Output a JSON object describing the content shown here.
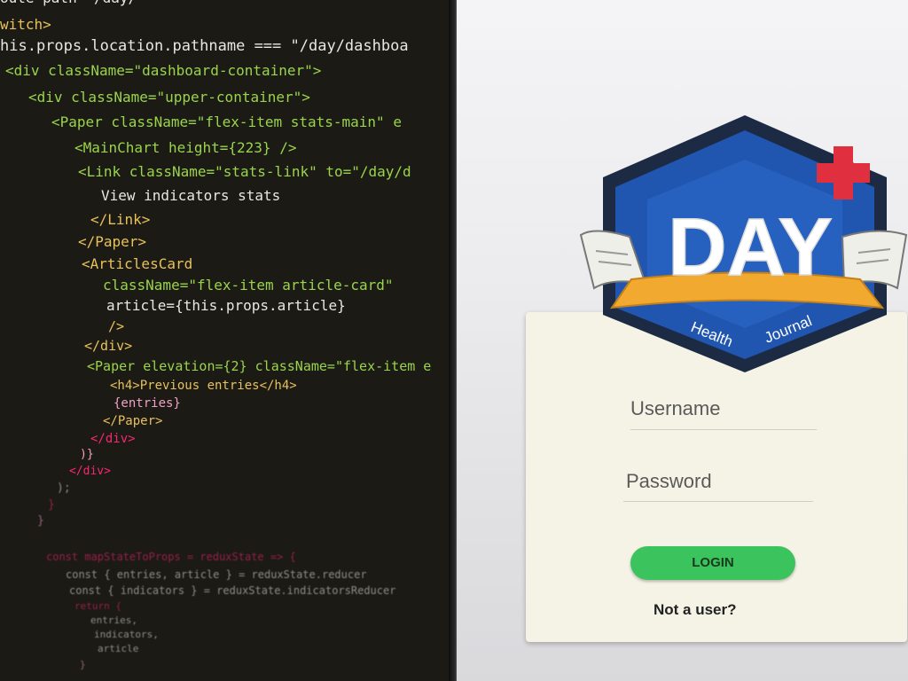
{
  "editor": {
    "lines": [
      "oute path=\"/day/",
      "witch>",
      "his.props.location.pathname === \"/day/dashboa",
      "<div className=\"dashboard-container\">",
      "<div className=\"upper-container\">",
      "<Paper className=\"flex-item stats-main\" e",
      "<MainChart height={223} />",
      "<Link className=\"stats-link\" to=\"/day/d",
      "View indicators stats",
      "</Link>",
      "</Paper>",
      "<ArticlesCard",
      "className=\"flex-item article-card\"",
      "article={this.props.article}",
      "/>",
      "</div>",
      "<Paper elevation={2} className=\"flex-item e",
      "<h4>Previous entries</h4>",
      "{entries}",
      "</Paper>",
      "</div>",
      ")}",
      "</div>",
      ");",
      "}",
      "}",
      "const mapStateToProps = reduxState => {",
      "const { entries, article } = reduxState.reducer",
      "const { indicators } = reduxState.indicatorsReducer",
      "return {",
      "entries,",
      "indicators,",
      "article",
      "}"
    ]
  },
  "app": {
    "logo": {
      "title": "DAY",
      "ribbon_left": "Health",
      "ribbon_right": "Journal"
    },
    "login": {
      "username_label": "Username",
      "password_label": "Password",
      "login_label": "LOGIN",
      "signup_link": "Not a user?"
    },
    "colors": {
      "login_button": "#3bc45d",
      "logo_blue": "#2056b0",
      "logo_cross": "#e0303f"
    }
  }
}
